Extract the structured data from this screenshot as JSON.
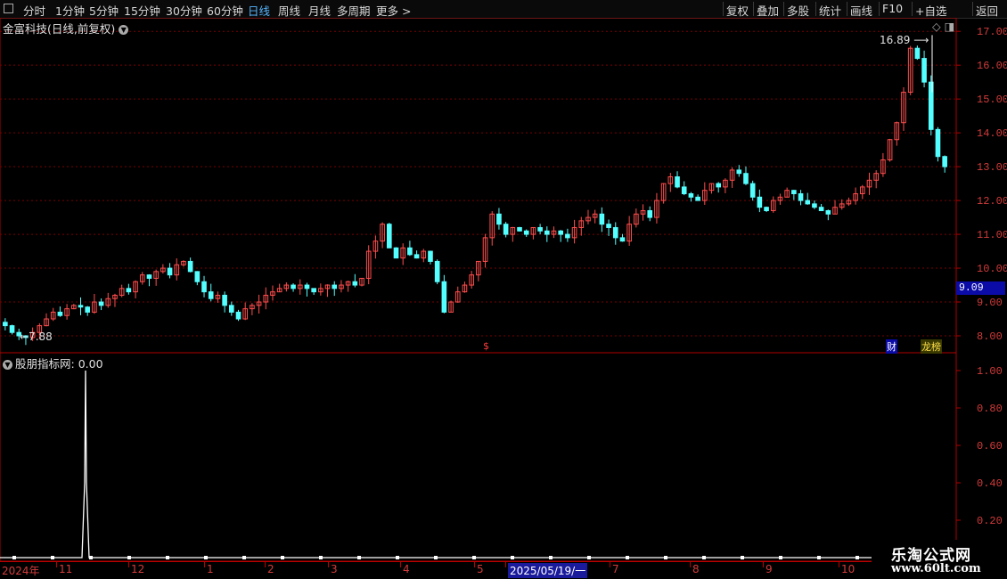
{
  "toolbar": {
    "left_items": [
      "分时",
      "1分钟",
      "5分钟",
      "15分钟",
      "30分钟",
      "60分钟",
      "日线",
      "周线",
      "月线",
      "多周期",
      "更多 >"
    ],
    "active": "日线",
    "right_items": [
      "复权",
      "叠加",
      "多股",
      "统计",
      "画线",
      "F10",
      "+自选",
      "返回"
    ]
  },
  "main": {
    "title": "金富科技(日线,前复权)",
    "high_label": "16.89",
    "low_label": "←7.88",
    "current_price": "9.09",
    "badges": {
      "s": "$",
      "fin": "财",
      "rank": "龙榜"
    },
    "price_axis": [
      "17.00",
      "16.00",
      "15.00",
      "14.00",
      "13.00",
      "12.00",
      "11.00",
      "10.00",
      "9.00",
      "8.00"
    ],
    "price_range": [
      7.5,
      17.4
    ]
  },
  "indicator": {
    "title": "股朋指标网",
    "value": ": 0.00",
    "axis": [
      "1.00",
      "0.80",
      "0.60",
      "0.40",
      "0.20"
    ],
    "spike_at": 0.1
  },
  "timebar": {
    "labels": [
      "2024年",
      "11",
      "12",
      "1",
      "2",
      "3",
      "4",
      "5",
      "2025/05/19/一",
      "7",
      "8",
      "9",
      "10"
    ],
    "selected": "2025/05/19/一"
  },
  "watermark": {
    "line1": "乐淘公式网",
    "line2": "www.60lt.com"
  },
  "colors": {
    "up": "#ff4d4d",
    "down": "#54ffff",
    "grid": "#7a0000",
    "axis": "#b00000"
  },
  "chart_data": {
    "type": "candlestick",
    "title": "金富科技(日线,前复权)",
    "yrange": [
      7.5,
      17.4
    ],
    "closes": [
      8.3,
      8.1,
      8.0,
      7.95,
      8.1,
      8.3,
      8.5,
      8.7,
      8.6,
      8.8,
      8.9,
      8.85,
      8.7,
      9.0,
      8.9,
      9.1,
      9.2,
      9.4,
      9.3,
      9.6,
      9.8,
      9.7,
      9.9,
      10.0,
      9.8,
      10.1,
      10.2,
      9.9,
      9.6,
      9.3,
      9.1,
      9.2,
      8.9,
      8.7,
      8.5,
      8.8,
      8.9,
      9.0,
      9.2,
      9.3,
      9.4,
      9.5,
      9.4,
      9.5,
      9.4,
      9.3,
      9.4,
      9.5,
      9.4,
      9.5,
      9.6,
      9.5,
      9.7,
      10.5,
      10.8,
      11.3,
      10.6,
      10.3,
      10.6,
      10.4,
      10.3,
      10.5,
      10.2,
      9.6,
      8.7,
      9.0,
      9.3,
      9.5,
      9.8,
      10.2,
      10.9,
      11.6,
      11.3,
      11.0,
      11.2,
      11.1,
      11.0,
      11.2,
      11.1,
      11.0,
      11.1,
      11.0,
      10.9,
      11.2,
      11.4,
      11.5,
      11.6,
      11.3,
      11.2,
      10.9,
      10.8,
      11.3,
      11.6,
      11.7,
      11.5,
      12.0,
      12.5,
      12.7,
      12.4,
      12.2,
      12.1,
      12.0,
      12.3,
      12.5,
      12.4,
      12.6,
      12.9,
      12.8,
      12.5,
      12.1,
      11.8,
      11.7,
      12.0,
      12.1,
      12.3,
      12.2,
      12.0,
      11.9,
      11.8,
      11.7,
      11.6,
      11.8,
      11.9,
      12.0,
      12.2,
      12.4,
      12.6,
      12.8,
      13.2,
      13.8,
      14.3,
      15.2,
      16.5,
      16.2,
      15.5,
      14.1,
      13.3,
      13.0
    ]
  }
}
